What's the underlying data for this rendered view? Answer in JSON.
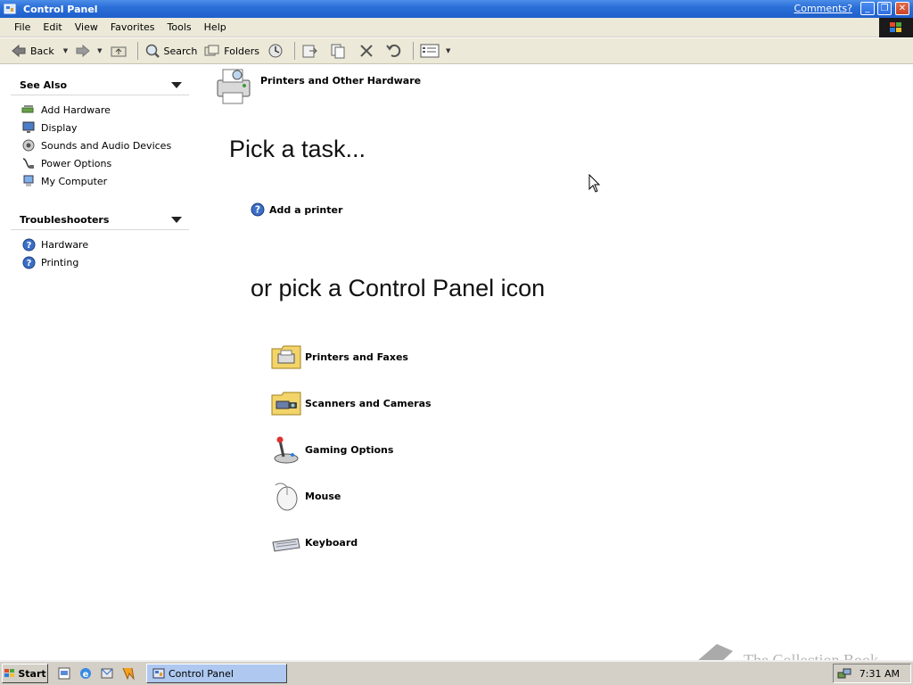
{
  "window": {
    "title": "Control Panel",
    "comments_link": "Comments?"
  },
  "menu": [
    "File",
    "Edit",
    "View",
    "Favorites",
    "Tools",
    "Help"
  ],
  "toolbar": {
    "back": "Back",
    "search": "Search",
    "folders": "Folders"
  },
  "sidebar": {
    "see_also": {
      "title": "See Also",
      "items": [
        {
          "label": "Add Hardware",
          "icon": "add-hardware-icon"
        },
        {
          "label": "Display",
          "icon": "display-icon"
        },
        {
          "label": "Sounds and Audio Devices",
          "icon": "speaker-icon"
        },
        {
          "label": "Power Options",
          "icon": "power-plug-icon"
        },
        {
          "label": "My Computer",
          "icon": "computer-icon"
        }
      ]
    },
    "troubleshooters": {
      "title": "Troubleshooters",
      "items": [
        {
          "label": "Hardware",
          "icon": "help-icon"
        },
        {
          "label": "Printing",
          "icon": "help-icon"
        }
      ]
    }
  },
  "main": {
    "category": "Printers and Other Hardware",
    "pick_task": "Pick a task...",
    "tasks": [
      {
        "label": "Add a printer",
        "icon": "help-icon"
      }
    ],
    "pick_icon": "or pick a Control Panel icon",
    "icons": [
      {
        "label": "Printers and Faxes",
        "icon": "printers-faxes-icon"
      },
      {
        "label": "Scanners and Cameras",
        "icon": "scanner-camera-icon"
      },
      {
        "label": "Gaming Options",
        "icon": "joystick-icon"
      },
      {
        "label": "Mouse",
        "icon": "mouse-icon"
      },
      {
        "label": "Keyboard",
        "icon": "keyboard-icon"
      }
    ]
  },
  "taskbar": {
    "start": "Start",
    "active_window": "Control Panel",
    "clock": "7:31 AM"
  },
  "watermark": "The Collection Book",
  "colors": {
    "titlebar": "#2b6fd8",
    "chrome": "#ece9d8",
    "taskbar": "#d4d0c8",
    "active_task": "#aec8f0"
  }
}
